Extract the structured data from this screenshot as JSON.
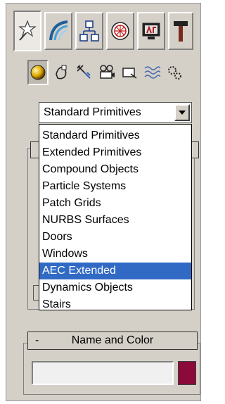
{
  "tabs": [
    {
      "icon": "create-icon",
      "active": true
    },
    {
      "icon": "modify-icon",
      "active": false
    },
    {
      "icon": "hierarchy-icon",
      "active": false
    },
    {
      "icon": "motion-icon",
      "active": false
    },
    {
      "icon": "display-icon",
      "active": false
    },
    {
      "icon": "utilities-icon",
      "active": false
    }
  ],
  "categories": [
    {
      "icon": "geometry-icon",
      "active": true
    },
    {
      "icon": "shapes-icon",
      "active": false
    },
    {
      "icon": "lights-icon",
      "active": false
    },
    {
      "icon": "cameras-icon",
      "active": false
    },
    {
      "icon": "helpers-icon",
      "active": false
    },
    {
      "icon": "space-warps-icon",
      "active": false
    },
    {
      "icon": "systems-icon",
      "active": false
    }
  ],
  "dropdown": {
    "selected_value": "Standard Primitives",
    "options": [
      "Standard Primitives",
      "Extended Primitives",
      "Compound Objects",
      "Particle Systems",
      "Patch Grids",
      "NURBS Surfaces",
      "Doors",
      "Windows",
      "AEC Extended",
      "Dynamics Objects",
      "Stairs"
    ],
    "highlighted_option": "AEC Extended"
  },
  "name_and_color": {
    "collapse_symbol": "-",
    "title": "Name and Color",
    "name_value": "",
    "swatch_color": "#8b0a3a"
  },
  "colors": {
    "panel_bg": "#d4d0c8",
    "highlight": "#316ac5"
  }
}
